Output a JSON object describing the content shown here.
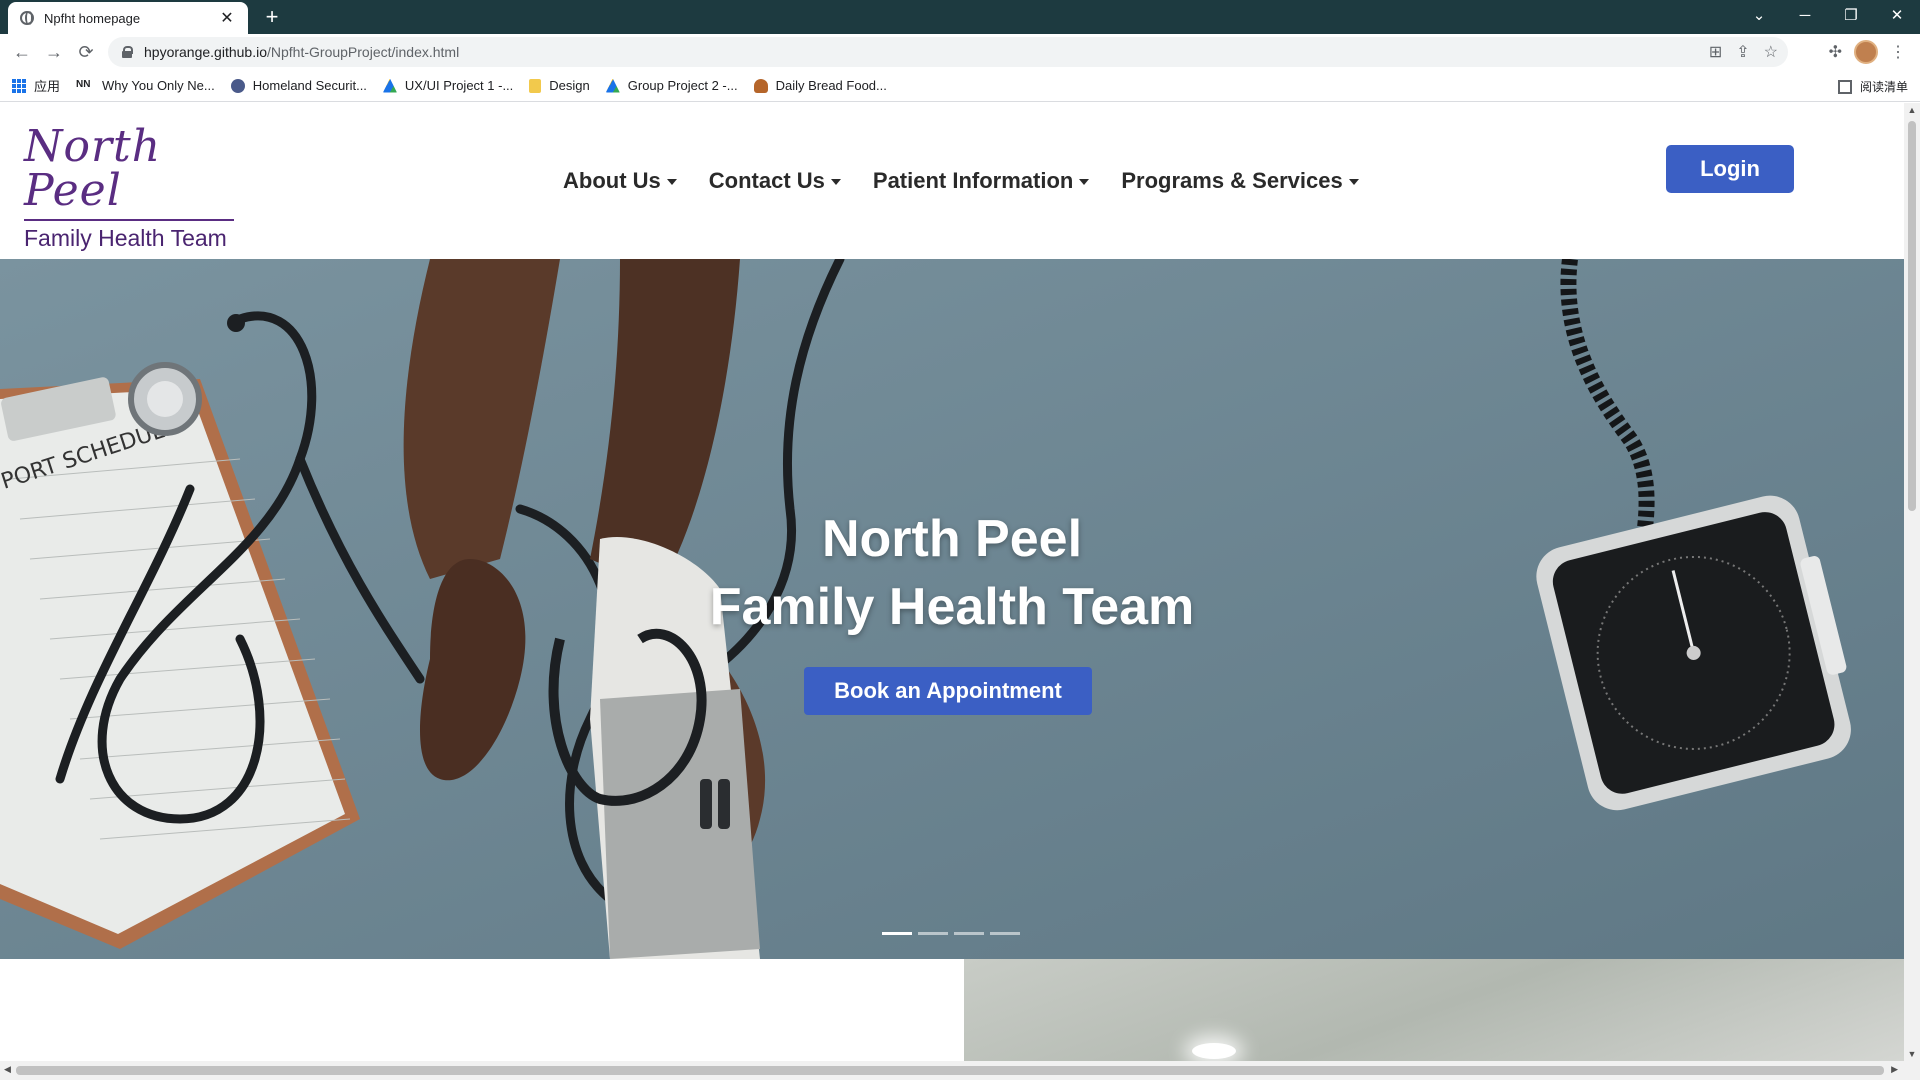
{
  "browser": {
    "tab_title": "Npfht homepage",
    "tab_close": "✕",
    "new_tab": "+",
    "window_controls": [
      "⌄",
      "─",
      "❐",
      "✕"
    ],
    "nav": {
      "back": "←",
      "forward": "→",
      "reload": "⟳"
    },
    "url_host": "hpyorange.github.io",
    "url_path": "/Npfht-GroupProject/index.html",
    "bookmarks": [
      {
        "label": "应用",
        "icon": "apps-grid-icon",
        "color": "#1a73e8"
      },
      {
        "label": "Why You Only Ne...",
        "icon": "nn-icon",
        "color": "#202124"
      },
      {
        "label": "Homeland Securit...",
        "icon": "seal-icon",
        "color": "#4a5a8a"
      },
      {
        "label": "UX/UI Project 1 -...",
        "icon": "drive-icon",
        "color": "#1a73e8"
      },
      {
        "label": "Design",
        "icon": "folder-icon",
        "color": "#f2c94c"
      },
      {
        "label": "Group Project 2 -...",
        "icon": "drive-icon",
        "color": "#1a73e8"
      },
      {
        "label": "Daily Bread Food...",
        "icon": "bread-icon",
        "color": "#b5652a"
      }
    ],
    "reading_list": "阅读清单"
  },
  "site": {
    "logo_script": "North Peel",
    "logo_sub": "Family Health Team",
    "nav": [
      {
        "label": "About Us"
      },
      {
        "label": "Contact Us"
      },
      {
        "label": "Patient Information"
      },
      {
        "label": "Programs & Services"
      }
    ],
    "login": "Login"
  },
  "hero": {
    "title_line1": "North Peel",
    "title_line2": "Family Health Team",
    "cta": "Book an Appointment",
    "slides": 4,
    "active_slide": 1,
    "clipboard_text": "PORT SCHEDULE"
  },
  "colors": {
    "brand_purple": "#5a2d82",
    "button_blue": "#3b5fc4",
    "hero_bg": "#6e8896",
    "tabbar": "#1d3a40"
  }
}
